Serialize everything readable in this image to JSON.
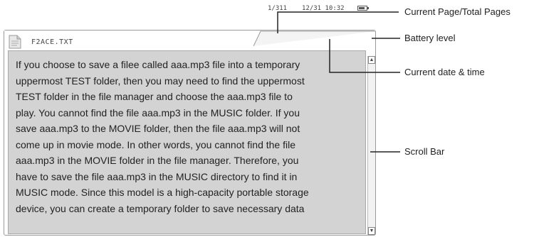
{
  "file": {
    "name": "F2ACE.TXT"
  },
  "status": {
    "page": "1/311",
    "datetime": "12/31 10:32",
    "battery_level": 0.8
  },
  "content": {
    "lines": [
      "If you choose to save a filee called aaa.mp3 file into a temporary",
      "uppermost TEST folder, then you may need to find the uppermost",
      "TEST folder in the file manager and choose the aaa.mp3 file to",
      "play. You cannot find the file aaa.mp3 in the MUSIC folder. If you",
      "save aaa.mp3 to the MOVIE folder, then the file aaa.mp3 will not",
      "come up in movie mode. In other words, you cannot find the file",
      "aaa.mp3 in the MOVIE folder in the file manager. Therefore, you",
      "have to save the file aaa.mp3 in the MUSIC directory to find it in",
      "MUSIC mode. Since this model is a high-capacity portable storage",
      "device, you can create a temporary folder to save necessary data"
    ]
  },
  "callouts": {
    "page": "Current Page/Total Pages",
    "battery": "Battery level",
    "datetime": "Current date & time",
    "scrollbar": "Scroll Bar"
  },
  "icons": {
    "document": "document-icon",
    "battery": "battery-icon",
    "scroll_up": "arrow-up-icon",
    "scroll_down": "arrow-down-icon"
  },
  "colors": {
    "content_bg": "#d3d3d3",
    "text": "#222222",
    "frame": "#9a9a9a"
  }
}
